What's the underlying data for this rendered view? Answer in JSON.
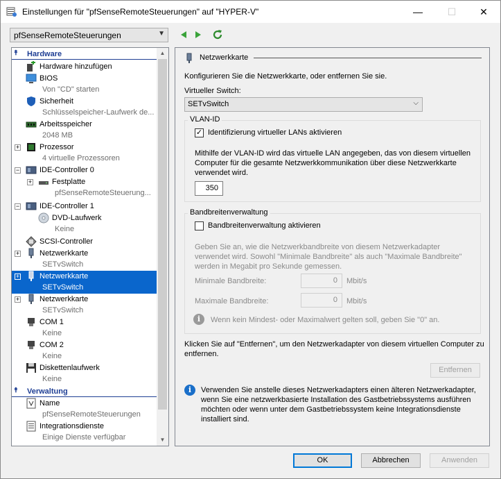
{
  "window": {
    "title": "Einstellungen für \"pfSenseRemoteSteuerungen\" auf \"HYPER-V\"",
    "minimize": "—",
    "maximize": "☐",
    "close": "✕"
  },
  "vm_selector": {
    "value": "pfSenseRemoteSteuerungen"
  },
  "tree": {
    "hardware_section": "Hardware",
    "management_section": "Verwaltung",
    "items": [
      {
        "label": "Hardware hinzufügen",
        "sub": ""
      },
      {
        "label": "BIOS",
        "sub": "Von \"CD\" starten"
      },
      {
        "label": "Sicherheit",
        "sub": "Schlüsselspeicher-Laufwerk de..."
      },
      {
        "label": "Arbeitsspeicher",
        "sub": "2048 MB"
      },
      {
        "label": "Prozessor",
        "sub": "4 virtuelle Prozessoren"
      },
      {
        "label": "IDE-Controller 0",
        "sub": ""
      },
      {
        "label": "Festplatte",
        "sub": "pfSenseRemoteSteuerung..."
      },
      {
        "label": "IDE-Controller 1",
        "sub": ""
      },
      {
        "label": "DVD-Laufwerk",
        "sub": "Keine"
      },
      {
        "label": "SCSI-Controller",
        "sub": ""
      },
      {
        "label": "Netzwerkkarte",
        "sub": "SETvSwitch"
      },
      {
        "label": "Netzwerkkarte",
        "sub": "SETvSwitch"
      },
      {
        "label": "Netzwerkkarte",
        "sub": "SETvSwitch"
      },
      {
        "label": "COM 1",
        "sub": "Keine"
      },
      {
        "label": "COM 2",
        "sub": "Keine"
      },
      {
        "label": "Diskettenlaufwerk",
        "sub": "Keine"
      },
      {
        "label": "Name",
        "sub": "pfSenseRemoteSteuerungen"
      },
      {
        "label": "Integrationsdienste",
        "sub": "Einige Dienste verfügbar"
      }
    ]
  },
  "panel": {
    "title": "Netzwerkkarte",
    "intro": "Konfigurieren Sie die Netzwerkkarte, oder entfernen Sie sie.",
    "switch_label": "Virtueller Switch:",
    "switch_value": "SETvSwitch",
    "vlan": {
      "group_label": "VLAN-ID",
      "checkbox_label": "Identifizierung virtueller LANs aktivieren",
      "checked": true,
      "description": "Mithilfe der VLAN-ID wird das virtuelle LAN angegeben, das von diesem virtuellen Computer für die gesamte Netzwerkkommunikation über diese Netzwerkkarte verwendet wird.",
      "value": "350"
    },
    "bandwidth": {
      "group_label": "Bandbreitenverwaltung",
      "checkbox_label": "Bandbreitenverwaltung aktivieren",
      "checked": false,
      "description": "Geben Sie an, wie die Netzwerkbandbreite von diesem Netzwerkadapter verwendet wird. Sowohl \"Minimale Bandbreite\" als auch \"Maximale Bandbreite\" werden in Megabit pro Sekunde gemessen.",
      "min_label": "Minimale Bandbreite:",
      "min_value": "0",
      "max_label": "Maximale Bandbreite:",
      "max_value": "0",
      "unit": "Mbit/s",
      "hint": "Wenn kein Mindest- oder Maximalwert gelten soll, geben Sie \"0\" an."
    },
    "remove_text": "Klicken Sie auf \"Entfernen\", um den Netzwerkadapter von diesem virtuellen Computer zu entfernen.",
    "remove_button": "Entfernen",
    "legacy_info": "Verwenden Sie anstelle dieses Netzwerkadapters einen älteren Netzwerkadapter, wenn Sie eine netzwerkbasierte Installation des Gastbetriebssystems ausführen möchten oder wenn unter dem Gastbetriebssystem keine Integrationsdienste installiert sind."
  },
  "buttons": {
    "ok": "OK",
    "cancel": "Abbrechen",
    "apply": "Anwenden"
  },
  "colors": {
    "accent": "#0a66cc",
    "section": "#1e3e94",
    "info_blue": "#1a6fc9",
    "info_gray": "#8a8a8a"
  }
}
